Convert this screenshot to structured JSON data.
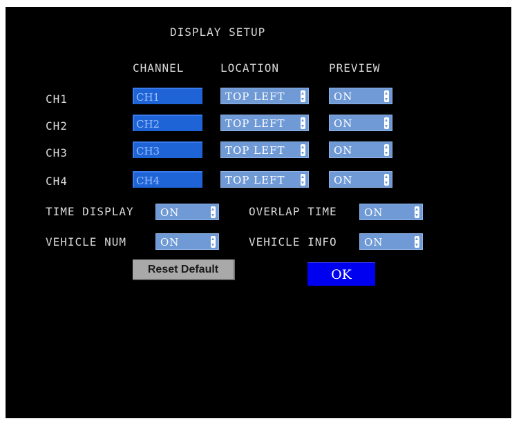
{
  "title": "DISPLAY SETUP",
  "headers": {
    "channel": "CHANNEL",
    "location": "LOCATION",
    "preview": "PREVIEW"
  },
  "rows": [
    {
      "label": "CH1",
      "name": "CH1",
      "location": "TOP LEFT",
      "preview": "ON"
    },
    {
      "label": "CH2",
      "name": "CH2",
      "location": "TOP LEFT",
      "preview": "ON"
    },
    {
      "label": "CH3",
      "name": "CH3",
      "location": "TOP LEFT",
      "preview": "ON"
    },
    {
      "label": "CH4",
      "name": "CH4",
      "location": "TOP LEFT",
      "preview": "ON"
    }
  ],
  "options": {
    "time_display": {
      "label": "TIME DISPLAY",
      "value": "ON"
    },
    "overlap_time": {
      "label": "OVERLAP TIME",
      "value": "ON"
    },
    "vehicle_num": {
      "label": "VEHICLE NUM",
      "value": "ON"
    },
    "vehicle_info": {
      "label": "VEHICLE INFO",
      "value": "ON"
    }
  },
  "buttons": {
    "reset": "Reset Default",
    "ok": "OK"
  },
  "colors": {
    "background": "#000000",
    "name_field": "#1f64d6",
    "select_field": "#6f9ad6",
    "ok_button": "#0000f0",
    "reset_button": "#a9a9a9",
    "label_text": "#d8d8d8"
  }
}
